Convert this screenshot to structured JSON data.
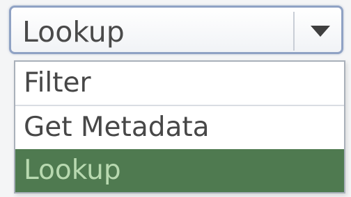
{
  "combo": {
    "value": "Lookup",
    "arrow_icon": "triangle-down-icon"
  },
  "dropdown": {
    "options": [
      {
        "label": "Filter"
      },
      {
        "label": "Get Metadata"
      },
      {
        "label": "Lookup",
        "selected": true
      }
    ]
  },
  "colors": {
    "selected_background": "#4f7a50",
    "selected_text": "#b8d9b0",
    "combo_border": "#8fa2c4"
  }
}
